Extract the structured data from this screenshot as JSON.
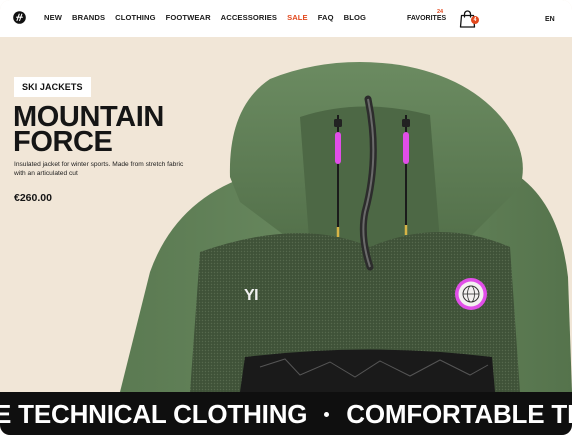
{
  "header": {
    "logo_icon": "brand-logo-icon",
    "nav": [
      {
        "label": "NEW"
      },
      {
        "label": "BRANDS"
      },
      {
        "label": "CLOTHING"
      },
      {
        "label": "FOOTWEAR"
      },
      {
        "label": "ACCESSORIES"
      },
      {
        "label": "SALE"
      },
      {
        "label": "FAQ"
      },
      {
        "label": "BLOG"
      }
    ],
    "favorites_label": "FAVORITES",
    "favorites_count": "24",
    "cart_icon": "shopping-bag-icon",
    "cart_count": "4",
    "language": "EN"
  },
  "hero": {
    "category_tag": "SKI JACKETS",
    "title_line1": "MOUNTAIN",
    "title_line2": "FORCE",
    "description": "Insulated jacket for winter sports. Made from stretch fabric with an articulated cut",
    "price": "€260.00",
    "jacket_print": "YI"
  },
  "ticker": {
    "item1": "E TECHNICAL CLOTHING",
    "item2": "COMFORTABLE TE"
  },
  "colors": {
    "accent": "#e2481d",
    "hero_bg": "#f1e6d7",
    "jacket_green": "#5f7e55",
    "ticker_bg": "#0f0f0f",
    "drawcord_pink": "#e14ee8"
  }
}
